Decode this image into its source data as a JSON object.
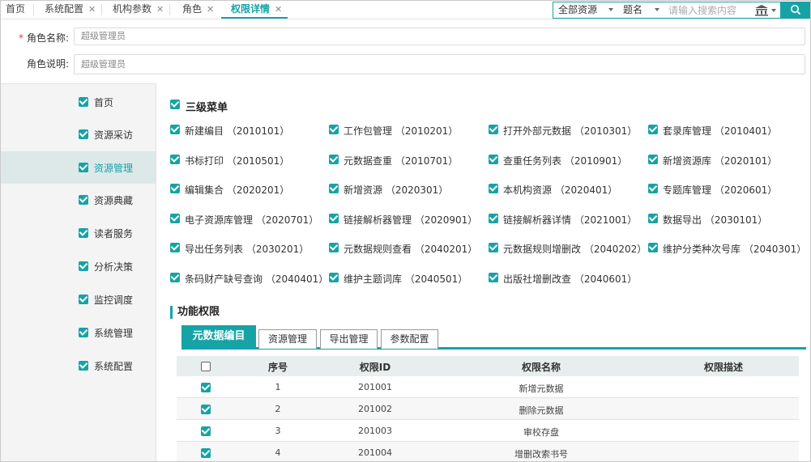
{
  "tabs": [
    {
      "label": "首页",
      "closable": false
    },
    {
      "label": "系统配置",
      "closable": true
    },
    {
      "label": "机构参数",
      "closable": true
    },
    {
      "label": "角色",
      "closable": true
    },
    {
      "label": "权限详情",
      "closable": true,
      "active": true
    }
  ],
  "search": {
    "scope": "全部资源",
    "field": "题名",
    "placeholder": "请输入搜索内容"
  },
  "form": {
    "role_name_label": "角色名称:",
    "role_name_value": "超级管理员",
    "role_desc_label": "角色说明:",
    "role_desc_value": "超级管理员"
  },
  "sidebar": {
    "items": [
      {
        "label": "首页",
        "checked": true
      },
      {
        "label": "资源采访",
        "checked": true
      },
      {
        "label": "资源管理",
        "checked": true,
        "active": true
      },
      {
        "label": "资源典藏",
        "checked": true
      },
      {
        "label": "读者服务",
        "checked": true
      },
      {
        "label": "分析决策",
        "checked": true
      },
      {
        "label": "监控调度",
        "checked": true
      },
      {
        "label": "系统管理",
        "checked": true
      },
      {
        "label": "系统配置",
        "checked": true
      }
    ]
  },
  "menu_section": {
    "title": "三级菜单",
    "items": [
      "新建编目 （2010101）",
      "工作包管理 （2010201）",
      "打开外部元数据 （2010301）",
      "套录库管理 （2010401）",
      "书标打印 （2010501）",
      "元数据查重 （2010701）",
      "查重任务列表 （2010901）",
      "新增资源库 （2020101）",
      "编辑集合 （2020201）",
      "新增资源 （2020301）",
      "本机构资源 （2020401）",
      "专题库管理 （2020601）",
      "电子资源库管理 （2020701）",
      "链接解析器管理 （2020901）",
      "链接解析器详情 （2021001）",
      "数据导出 （2030101）",
      "导出任务列表 （2030201）",
      "元数据规则查看 （2040201）",
      "元数据规则增删改 （2040202）",
      "维护分类种次号库 （2040301）",
      "条码财产缺号查询 （2040401）",
      "维护主题词库 （2040501）",
      "出版社增删改查 （2040601）"
    ]
  },
  "func_section": {
    "title": "功能权限",
    "subtabs": [
      "元数据编目",
      "资源管理",
      "导出管理",
      "参数配置"
    ],
    "active_subtab": 0
  },
  "table": {
    "headers": [
      "序号",
      "权限ID",
      "权限名称",
      "权限描述"
    ],
    "rows": [
      {
        "no": "1",
        "id": "201001",
        "name": "新增元数据",
        "desc": "",
        "checked": true
      },
      {
        "no": "2",
        "id": "201002",
        "name": "删除元数据",
        "desc": "",
        "checked": true
      },
      {
        "no": "3",
        "id": "201003",
        "name": "审校存盘",
        "desc": "",
        "checked": true
      },
      {
        "no": "4",
        "id": "201004",
        "name": "增删改索书号",
        "desc": "",
        "checked": true
      }
    ]
  },
  "colors": {
    "accent": "#16a3a6",
    "required": "#e23b3b"
  },
  "icons": {
    "close": "close-icon",
    "dropdown": "caret-down-icon",
    "library": "library-icon",
    "search": "search-icon",
    "checkbox": "checkbox-icon"
  }
}
